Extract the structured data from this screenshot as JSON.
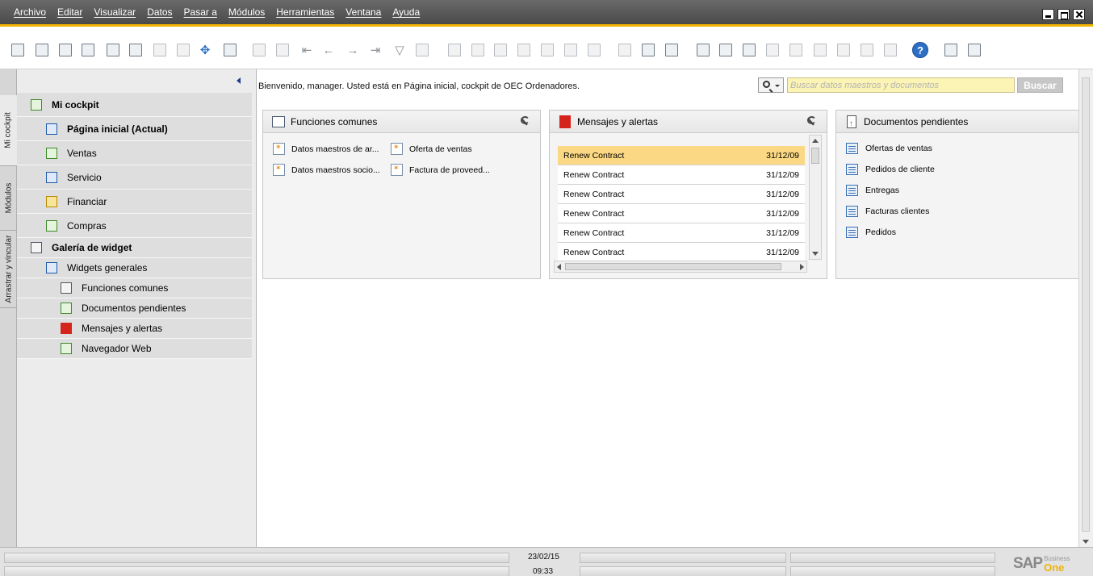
{
  "menu": [
    "Archivo",
    "Editar",
    "Visualizar",
    "Datos",
    "Pasar a",
    "Módulos",
    "Herramientas",
    "Ventana",
    "Ayuda"
  ],
  "vertical_tabs": [
    "Mi cockpit",
    "Módulos",
    "Arrastrar y vincular"
  ],
  "sidebar": {
    "my_cockpit": "Mi cockpit",
    "items": [
      {
        "label": "Página inicial (Actual)",
        "icon": "home-icon",
        "bold": true
      },
      {
        "label": "Ventas",
        "icon": "sales-icon"
      },
      {
        "label": "Servicio",
        "icon": "service-icon"
      },
      {
        "label": "Financiar",
        "icon": "finance-icon"
      },
      {
        "label": "Compras",
        "icon": "cart-icon"
      }
    ],
    "gallery": "Galería de widget",
    "general_widgets": "Widgets generales",
    "widgets": [
      {
        "label": "Funciones comunes",
        "icon": "common-functions-icon"
      },
      {
        "label": "Documentos pendientes",
        "icon": "pending-docs-icon"
      },
      {
        "label": "Mensajes y alertas",
        "icon": "alerts-icon"
      },
      {
        "label": "Navegador Web",
        "icon": "web-browser-icon"
      }
    ]
  },
  "main": {
    "welcome": "Bienvenido, manager. Usted está en Página inicial, cockpit de OEC Ordenadores.",
    "search_placeholder": "Buscar datos maestros y documentos",
    "search_button": "Buscar"
  },
  "widgets": {
    "common": {
      "title": "Funciones comunes",
      "items": [
        "Datos maestros de ar...",
        "Oferta de ventas",
        "Datos maestros socio...",
        "Factura de proveed..."
      ]
    },
    "alerts": {
      "title": "Mensajes y alertas",
      "rows": [
        {
          "subject": "Renew Contract",
          "date": "31/12/09"
        },
        {
          "subject": "Renew Contract",
          "date": "31/12/09"
        },
        {
          "subject": "Renew Contract",
          "date": "31/12/09"
        },
        {
          "subject": "Renew Contract",
          "date": "31/12/09"
        },
        {
          "subject": "Renew Contract",
          "date": "31/12/09"
        },
        {
          "subject": "Renew Contract",
          "date": "31/12/09"
        }
      ]
    },
    "pending": {
      "title": "Documentos pendientes",
      "items": [
        "Ofertas de ventas",
        "Pedidos de cliente",
        "Entregas",
        "Facturas clientes",
        "Pedidos"
      ]
    }
  },
  "status": {
    "date": "23/02/15",
    "time": "09:33",
    "logo_sap": "SAP",
    "logo_business": "Business",
    "logo_one": "One"
  },
  "colors": {
    "accent": "#f0b400",
    "selected_row": "#fbd883",
    "search_bg": "#fcf4b4"
  }
}
